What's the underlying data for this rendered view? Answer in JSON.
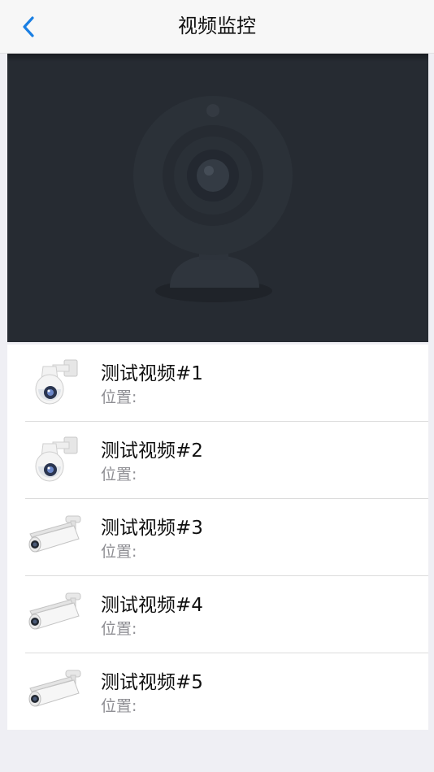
{
  "navbar": {
    "title": "视频监控",
    "back_icon": "chevron-left-icon",
    "accent_color": "#1a7fe3"
  },
  "player": {
    "placeholder_icon": "webcam-placeholder-icon",
    "background_color": "#262b32"
  },
  "cameras": [
    {
      "name": "测试视频#1",
      "location_label": "位置:",
      "icon": "ptz-dome-camera-icon"
    },
    {
      "name": "测试视频#2",
      "location_label": "位置:",
      "icon": "ptz-dome-camera-icon"
    },
    {
      "name": "测试视频#3",
      "location_label": "位置:",
      "icon": "bullet-camera-icon"
    },
    {
      "name": "测试视频#4",
      "location_label": "位置:",
      "icon": "bullet-camera-icon"
    },
    {
      "name": "测试视频#5",
      "location_label": "位置:",
      "icon": "bullet-camera-icon"
    }
  ]
}
